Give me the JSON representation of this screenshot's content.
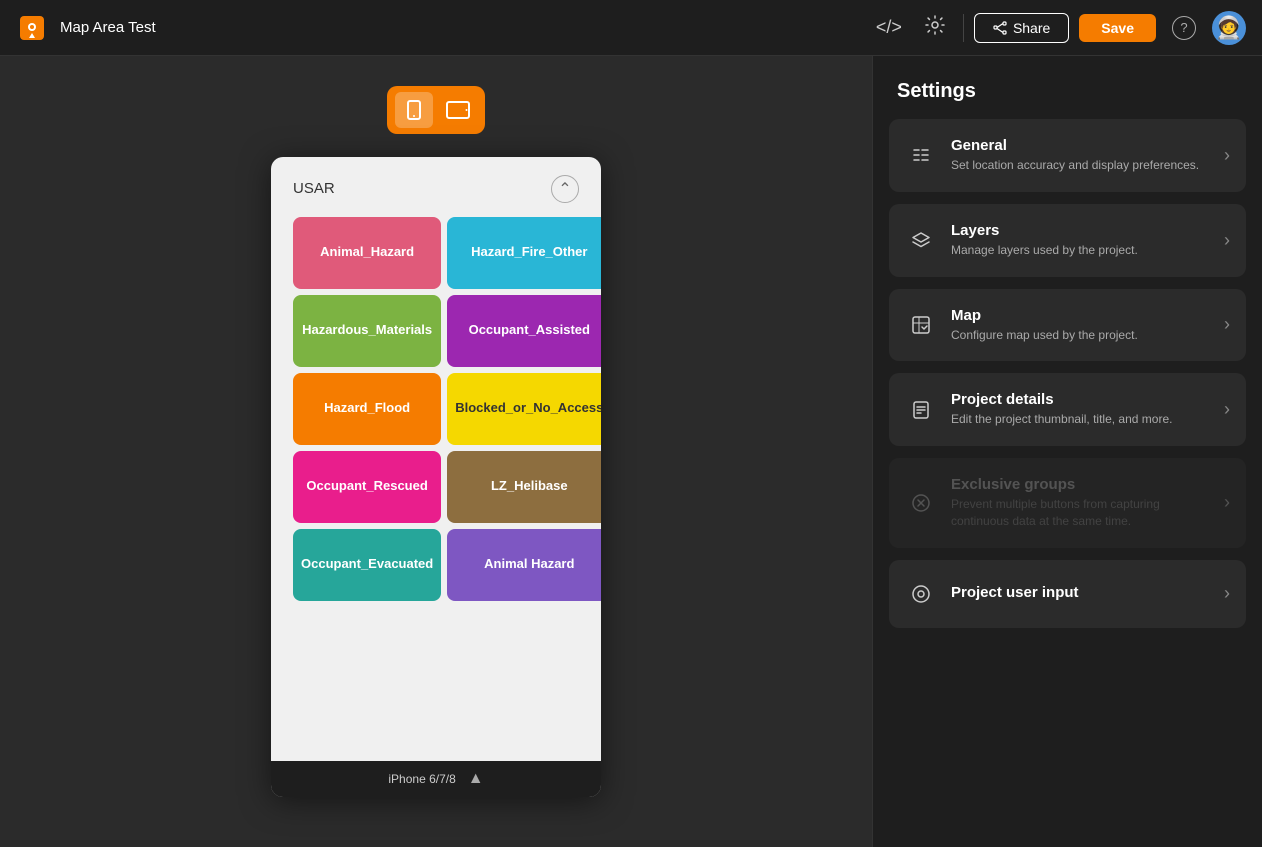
{
  "topbar": {
    "title": "Map Area Test",
    "share_label": "Share",
    "save_label": "Save",
    "code_icon": "</>",
    "settings_icon": "⚙",
    "help_icon": "?"
  },
  "device_toggle": {
    "phone_icon": "▭",
    "tablet_icon": "▭"
  },
  "phone": {
    "bottom_label": "iPhone 6/7/8",
    "section_label": "USAR"
  },
  "buttons": [
    {
      "label": "Animal_Hazard",
      "color": "#e05a7a"
    },
    {
      "label": "Hazard_Fire_Other",
      "color": "#29b6d6"
    },
    {
      "label": "Hazardous_Materials",
      "color": "#7cb342"
    },
    {
      "label": "Occupant_Assisted",
      "color": "#9c27b0"
    },
    {
      "label": "Hazard_Flood",
      "color": "#f57c00"
    },
    {
      "label": "Blocked_or_No_Access",
      "color": "#f5d800"
    },
    {
      "label": "Occupant_Rescued",
      "color": "#e91e8c"
    },
    {
      "label": "LZ_Helibase",
      "color": "#8d6e3f"
    },
    {
      "label": "Occupant_Evacuated",
      "color": "#26a69a"
    },
    {
      "label": "Animal Hazard",
      "color": "#7e57c2"
    }
  ],
  "settings": {
    "title": "Settings",
    "cards": [
      {
        "id": "general",
        "icon": "⊞",
        "title": "General",
        "desc": "Set location accuracy and display preferences.",
        "disabled": false
      },
      {
        "id": "layers",
        "icon": "⊕",
        "title": "Layers",
        "desc": "Manage layers used by the project.",
        "disabled": false
      },
      {
        "id": "map",
        "icon": "⊡",
        "title": "Map",
        "desc": "Configure map used by the project.",
        "disabled": false
      },
      {
        "id": "project-details",
        "icon": "≡",
        "title": "Project details",
        "desc": "Edit the project thumbnail, title, and more.",
        "disabled": false
      },
      {
        "id": "exclusive-groups",
        "icon": "⊗",
        "title": "Exclusive groups",
        "desc": "Prevent multiple buttons from capturing continuous data at the same time.",
        "disabled": true
      },
      {
        "id": "project-user-input",
        "icon": "⊙",
        "title": "Project user input",
        "desc": "",
        "disabled": false
      }
    ]
  }
}
